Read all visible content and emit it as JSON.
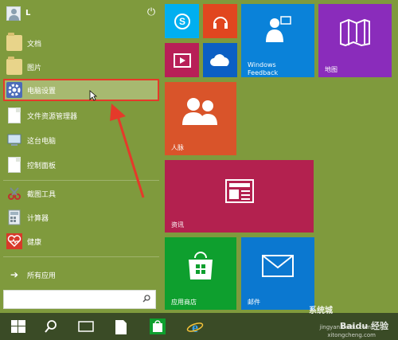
{
  "user": {
    "name": "L"
  },
  "menu": {
    "items": [
      {
        "label": "文档",
        "icon": "folder-icon"
      },
      {
        "label": "图片",
        "icon": "folder-icon"
      },
      {
        "label": "电脑设置",
        "icon": "gear-icon"
      },
      {
        "label": "文件资源管理器",
        "icon": "document-icon"
      },
      {
        "label": "这台电脑",
        "icon": "computer-icon"
      },
      {
        "label": "控制面板",
        "icon": "document-icon"
      },
      {
        "label": "截图工具",
        "icon": "scissors-icon"
      },
      {
        "label": "计算器",
        "icon": "calculator-icon"
      },
      {
        "label": "健康",
        "icon": "heart-icon"
      }
    ],
    "all_apps": "所有应用",
    "search_placeholder": ""
  },
  "tiles": {
    "skype": {
      "icon": "skype-icon",
      "color": "#00aff0"
    },
    "music": {
      "icon": "headphones-icon",
      "color": "#e1461f"
    },
    "windows_feedback": {
      "label_line1": "Windows",
      "label_line2": "Feedback",
      "icon": "feedback-person-icon",
      "color": "#0a82d9"
    },
    "maps": {
      "label": "地图",
      "icon": "map-icon",
      "color": "#8a2cbb"
    },
    "video": {
      "icon": "video-icon",
      "color": "#b81f57"
    },
    "onedrive": {
      "icon": "cloud-icon",
      "color": "#0b5fc4"
    },
    "people": {
      "label": "人脉",
      "icon": "people-icon",
      "color": "#d9542a"
    },
    "news": {
      "label": "资讯",
      "icon": "news-icon",
      "color": "#b3214f"
    },
    "store": {
      "label": "应用商店",
      "icon": "store-icon",
      "color": "#0e9f2e"
    },
    "mail": {
      "label": "邮件",
      "icon": "mail-icon",
      "color": "#0b78d0"
    }
  },
  "watermark": {
    "text": "Baidu 经验",
    "sub1": "jingyan.baidu.com",
    "sub2": "xitongcheng.com",
    "logo_text": "系统城"
  },
  "colors": {
    "desktop": "#7f9a3d",
    "taskbar": "#3a4b26",
    "selection_border": "#e53a2a",
    "arrow": "#e53a2a"
  }
}
